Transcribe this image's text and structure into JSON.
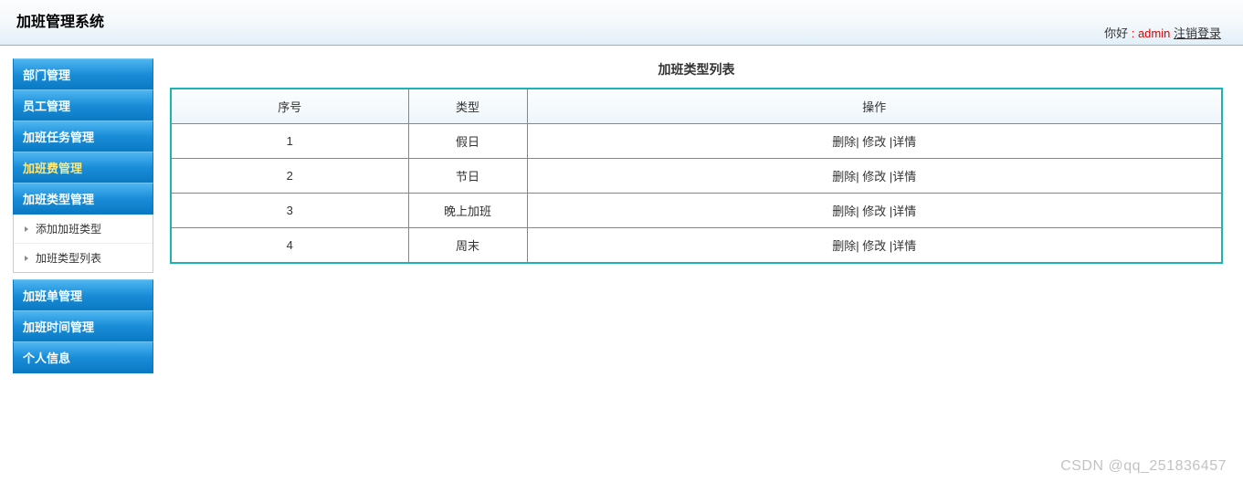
{
  "header": {
    "title": "加班管理系统",
    "greeting_prefix": "你好",
    "greeting_colon": " : ",
    "username": "admin",
    "logout_label": "注销登录"
  },
  "sidebar": {
    "items": [
      {
        "label": "部门管理",
        "active": false,
        "sub": []
      },
      {
        "label": "员工管理",
        "active": false,
        "sub": []
      },
      {
        "label": "加班任务管理",
        "active": false,
        "sub": []
      },
      {
        "label": "加班费管理",
        "active": true,
        "sub": []
      },
      {
        "label": "加班类型管理",
        "active": false,
        "sub": [
          {
            "label": "添加加班类型"
          },
          {
            "label": "加班类型列表"
          }
        ]
      },
      {
        "label": "加班单管理",
        "active": false,
        "sub": [],
        "gap_before": true
      },
      {
        "label": "加班时间管理",
        "active": false,
        "sub": []
      },
      {
        "label": "个人信息",
        "active": false,
        "sub": []
      }
    ]
  },
  "main": {
    "content_title": "加班类型列表",
    "columns": {
      "seq": "序号",
      "type": "类型",
      "ops": "操作"
    },
    "rows": [
      {
        "seq": "1",
        "type": "假日"
      },
      {
        "seq": "2",
        "type": "节日"
      },
      {
        "seq": "3",
        "type": "晚上加班"
      },
      {
        "seq": "4",
        "type": "周末"
      }
    ],
    "ops": {
      "delete": "删除",
      "edit": "修改",
      "detail": "详情",
      "sep": "| "
    }
  },
  "watermark": "CSDN @qq_251836457"
}
